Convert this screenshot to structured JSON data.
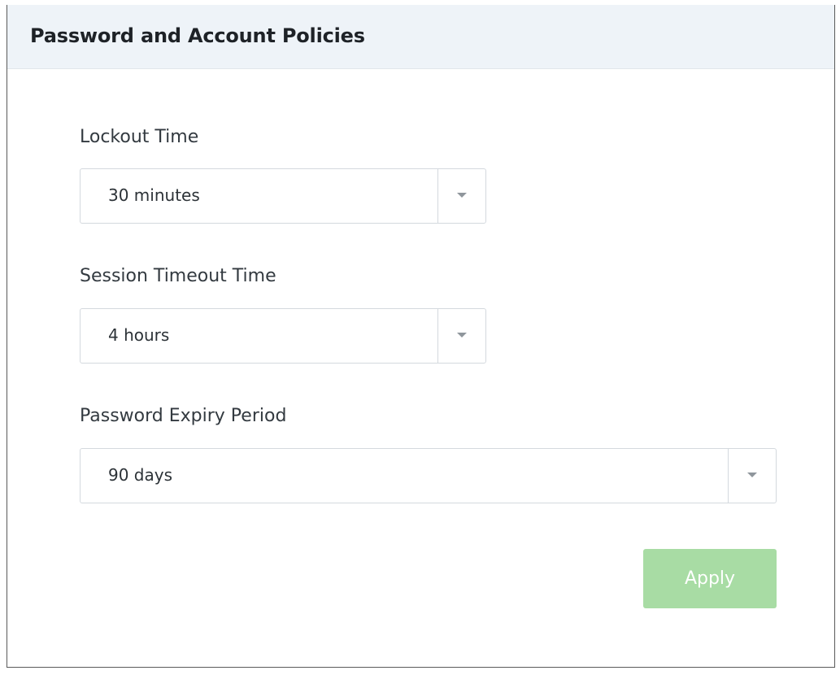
{
  "panel": {
    "title": "Password and Account Policies"
  },
  "fields": {
    "lockout": {
      "label": "Lockout Time",
      "value": "30 minutes",
      "icon": "chevron-down-icon"
    },
    "session": {
      "label": "Session Timeout Time",
      "value": "4 hours",
      "icon": "chevron-down-icon"
    },
    "expiry": {
      "label": "Password Expiry Period",
      "value": "90 days",
      "icon": "chevron-down-icon"
    }
  },
  "actions": {
    "apply_label": "Apply"
  },
  "colors": {
    "header_bg": "#eef3f8",
    "apply_bg": "#a8dca4",
    "border": "#d4d9de"
  }
}
